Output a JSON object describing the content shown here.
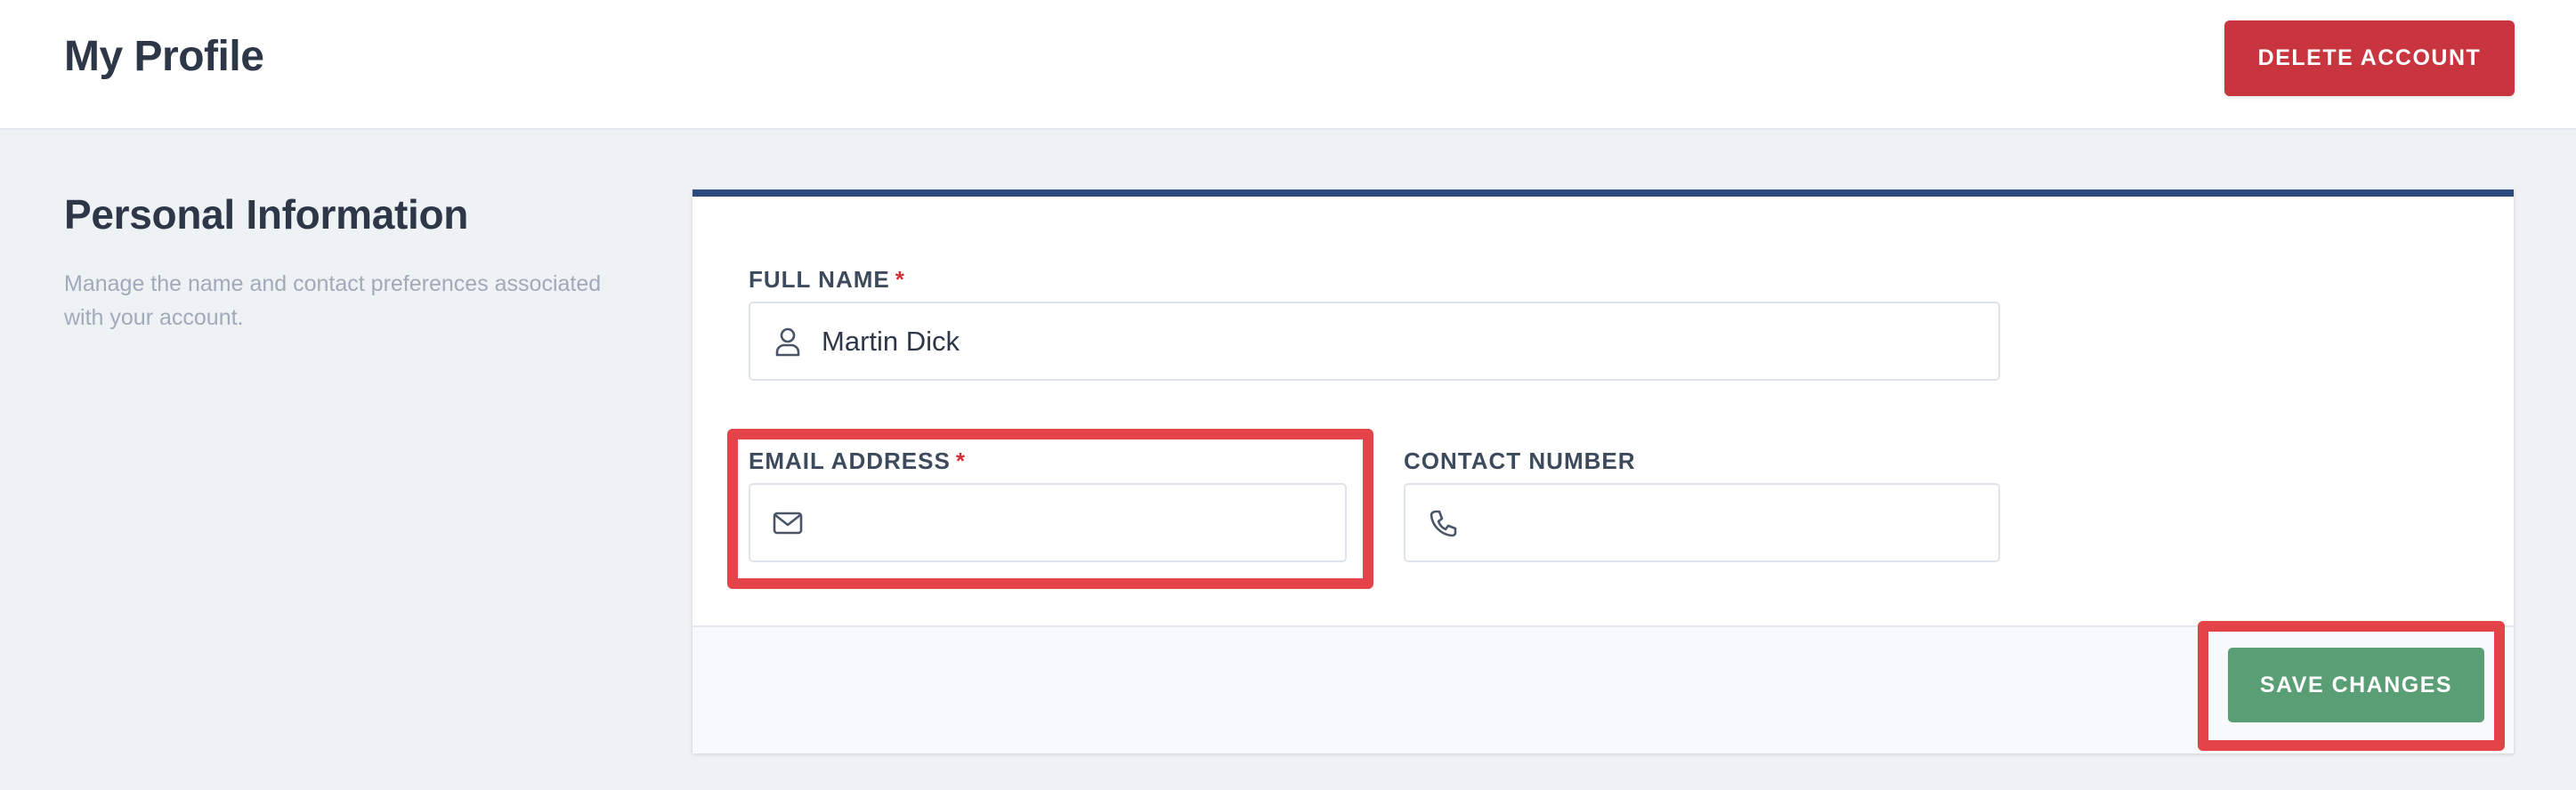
{
  "header": {
    "title": "My Profile",
    "delete_button": "DELETE ACCOUNT"
  },
  "section": {
    "title": "Personal Information",
    "description": "Manage the name and contact preferences associated with your account."
  },
  "form": {
    "full_name": {
      "label": "FULL NAME",
      "required_mark": "*",
      "value": "Martin Dick",
      "icon": "user-icon"
    },
    "email": {
      "label": "EMAIL ADDRESS",
      "required_mark": "*",
      "value": "",
      "icon": "mail-icon"
    },
    "contact": {
      "label": "CONTACT NUMBER",
      "value": "",
      "icon": "phone-icon"
    },
    "save_button": "SAVE CHANGES"
  },
  "colors": {
    "delete": "#c9353e",
    "save": "#5a9e75",
    "card_accent": "#2c4a7e",
    "highlight": "#e5434a"
  }
}
